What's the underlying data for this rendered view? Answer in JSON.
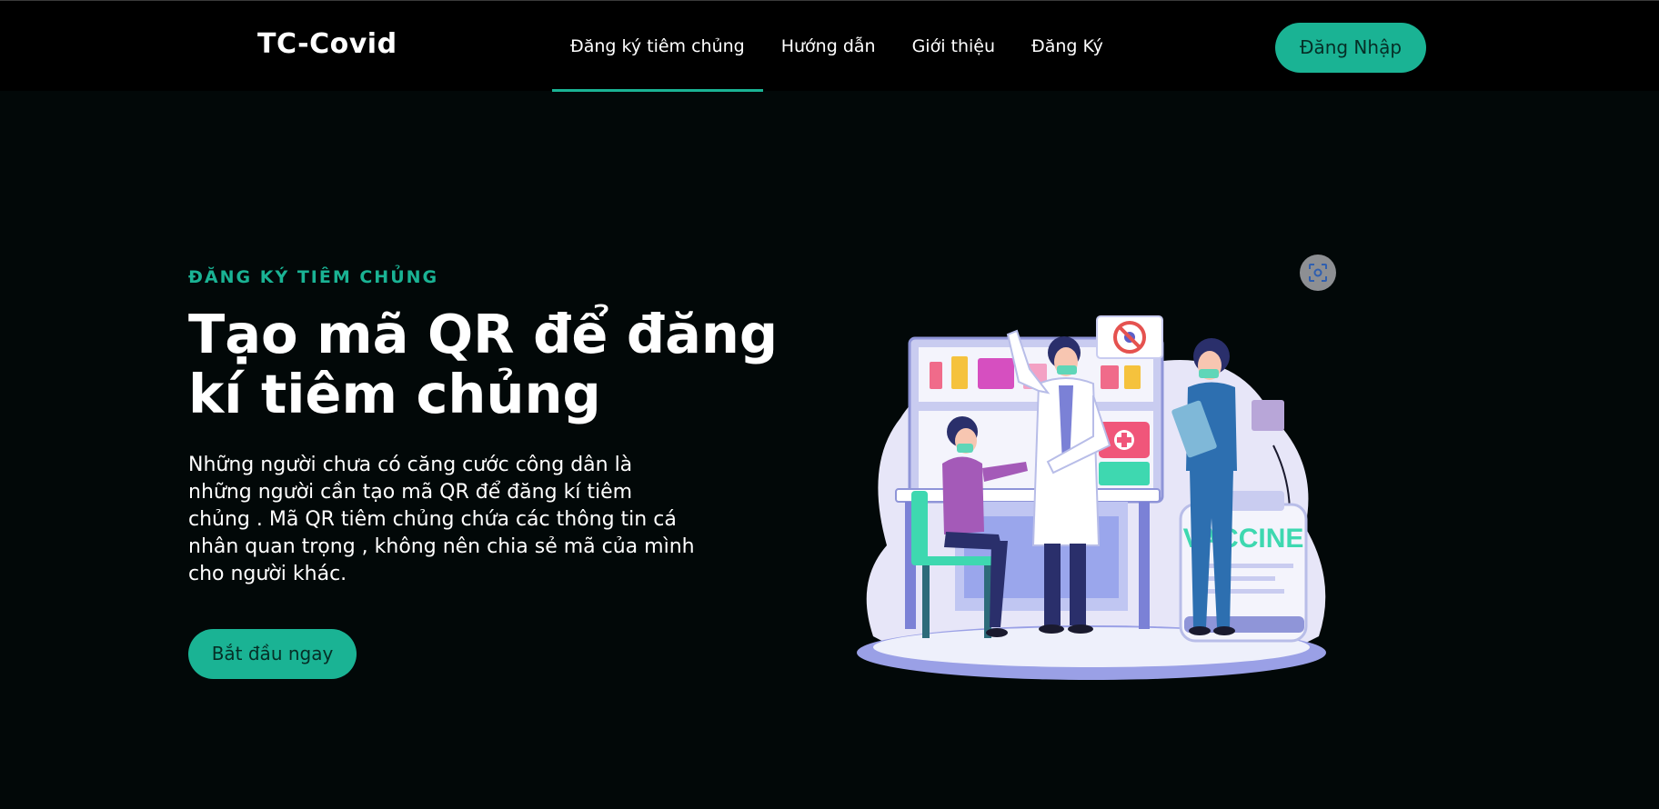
{
  "brand": "TC-Covid",
  "nav": {
    "items": [
      {
        "label": "Đăng ký tiêm chủng",
        "active": true
      },
      {
        "label": "Hướng dẫn"
      },
      {
        "label": "Giới thiệu"
      },
      {
        "label": "Đăng Ký"
      }
    ],
    "login_label": "Đăng Nhập"
  },
  "hero": {
    "eyebrow": "ĐĂNG KÝ TIÊM CHỦNG",
    "title": "Tạo mã QR để đăng kí tiêm chủng",
    "description": "Những người chưa có căng cước công dân là những người cần tạo mã QR để đăng kí tiêm chủng . Mã QR tiêm chủng chứa các thông tin cá nhân quan trọng , không nên chia sẻ mã của mình cho người khác.",
    "cta_label": "Bắt đầu ngay"
  },
  "illustration": {
    "vial_label": "VACCINE",
    "icons": [
      "lens-icon",
      "no-virus-icon",
      "medical-kit-icon"
    ]
  },
  "colors": {
    "accent": "#1ab394",
    "nav_bg": "#000000",
    "page_bg": "#020808"
  }
}
